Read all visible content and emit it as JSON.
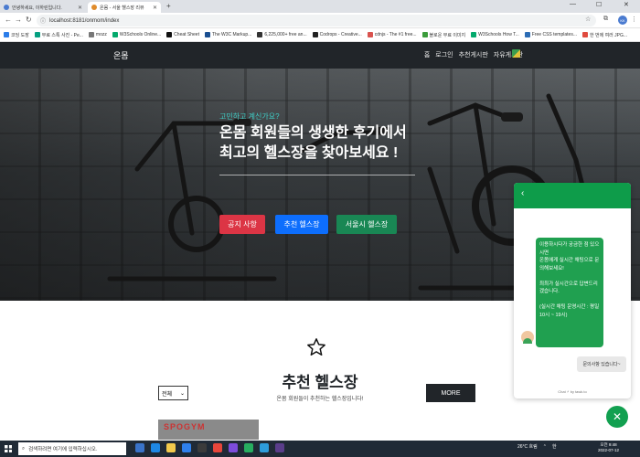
{
  "browser": {
    "tabs": [
      {
        "title": "안녕하세요, 이하린입니다."
      },
      {
        "title": "온몸 - 서울 헬스장 리뷰"
      }
    ],
    "new_tab": "+",
    "url": "localhost:8181/onmom/index",
    "profile": "KK",
    "bookmarks": [
      {
        "label": "코딩 도장",
        "color": "#2b7de9"
      },
      {
        "label": "무료 스톡 사진 - Pe...",
        "color": "#05a081"
      },
      {
        "label": "mozz",
        "color": "#777777"
      },
      {
        "label": "W3Schools Online...",
        "color": "#04aa6d"
      },
      {
        "label": "Cheat Sheet",
        "color": "#111111"
      },
      {
        "label": "The W3C Markup...",
        "color": "#1a4f91"
      },
      {
        "label": "6,225,000+ free an...",
        "color": "#333333"
      },
      {
        "label": "Codrops - Creative...",
        "color": "#222222"
      },
      {
        "label": "cdnjs - The #1 free...",
        "color": "#d9534f"
      },
      {
        "label": "블로운 무료 이미지",
        "color": "#3c9c3c"
      },
      {
        "label": "W3Schools How T...",
        "color": "#04aa6d"
      },
      {
        "label": "Free CSS templates...",
        "color": "#2d6db5"
      },
      {
        "label": "한 번에 여러 JPG...",
        "color": "#e04b3f"
      }
    ]
  },
  "site": {
    "brand": "온몸",
    "nav": [
      "홈",
      "로그인",
      "추천게시판",
      "자유게시판"
    ]
  },
  "hero": {
    "subtitle": "고민하고 계신가요?",
    "title_line1": "온몸 회원들의 생생한 후기에서",
    "title_line2": "최고의 헬스장을 찾아보세요 !",
    "buttons": {
      "notice": "공지 사항",
      "recommend": "추천 헬스장",
      "seoul": "서울시 헬스장"
    }
  },
  "section": {
    "title": "추천 헬스장",
    "subtitle": "온몸 회원들이 추천하는 헬스장입니다!",
    "filter_value": "전체",
    "more": "MORE",
    "card_sign": "SPOGYM"
  },
  "chat": {
    "back": "‹",
    "message_lines": [
      "이용하시다가 궁금한 점 있으시면",
      "온몸에게 실시간 채팅으로 문의해보세요!",
      "",
      "최최가 실시간으로 답변드리겠습니다.",
      "",
      "(실시간 채팅 운영시간 : 평일 10시 ~ 19시)"
    ],
    "reply": "문의사항 있습니다~",
    "footer": "Chat ⚡ by tawk.to"
  },
  "taskbar": {
    "search_placeholder": "검색하려면 여기에 입력하십시오.",
    "weather": "26°C 흐림",
    "lang": "한",
    "time": "오전 9:48",
    "date": "2022-07-12"
  },
  "colors": {
    "nav_bg": "#212529",
    "btn_red": "#dc3545",
    "btn_blue": "#0d6efd",
    "btn_green": "#198754",
    "chat_green": "#0e9c4a",
    "accent_teal": "#3fd0c8"
  }
}
